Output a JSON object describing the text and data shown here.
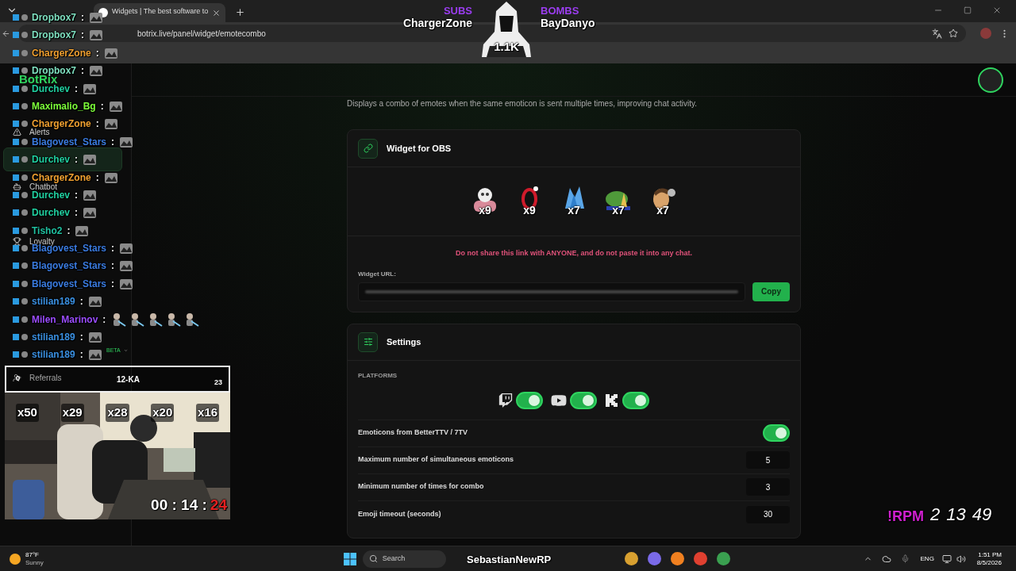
{
  "browser": {
    "tab_title": "Widgets | The best software to",
    "url": "botrix.live/panel/widget/emotecombo"
  },
  "sidebar": {
    "logo": "BotRix",
    "items": [
      {
        "label": "Alerts",
        "selected": false
      },
      {
        "selected": true
      },
      {
        "label": "Chatbot",
        "selected": false
      },
      {
        "label": "Loyalty",
        "selected": false
      },
      {
        "badge": "BETA",
        "expanded": false
      },
      {
        "label": "Referrals",
        "selected": false
      }
    ]
  },
  "page": {
    "description": "Displays a combo of emotes when the same emoticon is sent multiple times, improving chat activity.",
    "widget_card": {
      "title": "Widget for OBS",
      "emotes": [
        {
          "kind": "meme",
          "count": "x9"
        },
        {
          "kind": "scream",
          "count": "x9"
        },
        {
          "kind": "clap",
          "count": "x7"
        },
        {
          "kind": "frog",
          "count": "x7"
        },
        {
          "kind": "face",
          "count": "x7"
        }
      ],
      "warning": "Do not share this link with ANYONE, and do not paste it into any chat.",
      "url_label": "Widget URL:",
      "copy_button": "Copy"
    },
    "settings_card": {
      "title": "Settings",
      "platforms_label": "PLATFORMS",
      "platforms": [
        {
          "kind": "twitch",
          "on": true
        },
        {
          "kind": "youtube",
          "on": true
        },
        {
          "kind": "kick",
          "on": true
        }
      ],
      "rows": [
        {
          "kind": "toggle",
          "label": "Emoticons from BetterTTV / 7TV",
          "on": true
        },
        {
          "kind": "number",
          "label": "Maximum number of simultaneous emoticons",
          "value": "5"
        },
        {
          "kind": "number",
          "label": "Minimum number of times for combo",
          "value": "3"
        },
        {
          "kind": "number",
          "label": "Emoji timeout (seconds)",
          "value": "30"
        }
      ]
    }
  },
  "stream_overlay": {
    "subs_label": "SUBS",
    "subs_name": "ChargerZone",
    "bombs_label": "BOMBS",
    "bombs_name": "BayDanyo",
    "count": "1.1K",
    "chat": [
      {
        "name": "Dropbox7",
        "separator": ":",
        "color": "#7fe0c0",
        "kind": "single"
      },
      {
        "name": "Dropbox7",
        "separator": ":",
        "color": "#7fe0c0",
        "kind": "single"
      },
      {
        "name": "ChargerZone",
        "separator": ":",
        "color": "#f0a030",
        "kind": "single"
      },
      {
        "name": "Dropbox7",
        "separator": ":",
        "color": "#7fe0c0",
        "kind": "single"
      },
      {
        "name": "Durchev",
        "separator": ":",
        "color": "#20d0a0",
        "kind": "single"
      },
      {
        "name": "Maximalio_Bg",
        "separator": ":",
        "color": "#7dff3a",
        "kind": "single"
      },
      {
        "name": "ChargerZone",
        "separator": ":",
        "color": "#f0a030",
        "kind": "single"
      },
      {
        "name": "Blagovest_Stars",
        "separator": ":",
        "color": "#3a7be0",
        "kind": "single"
      },
      {
        "name": "Durchev",
        "separator": ":",
        "color": "#20d0a0",
        "kind": "single"
      },
      {
        "name": "ChargerZone",
        "separator": ":",
        "color": "#f0a030",
        "kind": "single"
      },
      {
        "name": "Durchev",
        "separator": ":",
        "color": "#20d0a0",
        "kind": "single"
      },
      {
        "name": "Durchev",
        "separator": ":",
        "color": "#20d0a0",
        "kind": "single"
      },
      {
        "name": "Tisho2",
        "separator": ":",
        "color": "#20c0a0",
        "kind": "single"
      },
      {
        "name": "Blagovest_Stars",
        "separator": ":",
        "color": "#3a7be0",
        "kind": "single"
      },
      {
        "name": "Blagovest_Stars",
        "separator": ":",
        "color": "#3a7be0",
        "kind": "single"
      },
      {
        "name": "Blagovest_Stars",
        "separator": ":",
        "color": "#3a7be0",
        "kind": "single"
      },
      {
        "name": "stilian189",
        "separator": ":",
        "color": "#3a8fe0",
        "kind": "single"
      },
      {
        "name": "Milen_Marinov",
        "separator": ":",
        "color": "#9b4dff",
        "kind": "multi"
      },
      {
        "name": "stilian189",
        "separator": ":",
        "color": "#3a8fe0",
        "kind": "single"
      },
      {
        "name": "stilian189",
        "separator": ":",
        "color": "#3a8fe0",
        "kind": "single"
      }
    ],
    "camera": {
      "goal": "12-KA",
      "goal_count": "23",
      "referral_count": "0",
      "emote_counts": [
        "x50",
        "x29",
        "x28",
        "x20",
        "x16"
      ],
      "timer": "00 : 14 :",
      "timer_seconds": "24"
    },
    "rpm": {
      "label": "!RPM",
      "values": [
        "2",
        "13",
        "49"
      ]
    },
    "tiktok_name": "SebastianNewRP"
  },
  "taskbar": {
    "temperature": "87°F",
    "weather": "Sunny",
    "search_placeholder": "Search",
    "language": "ENG",
    "time": "1:51 PM",
    "date": "8/5/2026"
  }
}
